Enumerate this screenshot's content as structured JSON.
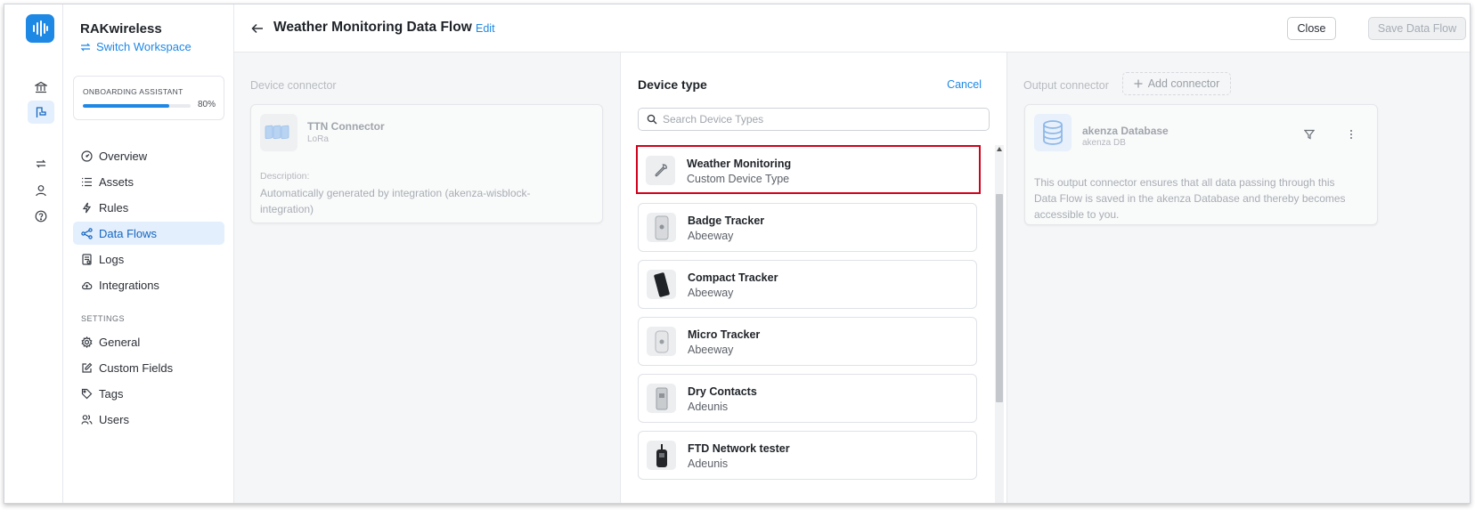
{
  "workspace": {
    "name": "RAKwireless",
    "switch_label": "Switch Workspace"
  },
  "onboarding": {
    "title": "ONBOARDING ASSISTANT",
    "progress_text": "80%",
    "progress": 0.8
  },
  "nav": {
    "items": [
      {
        "label": "Overview",
        "icon": "overview-icon"
      },
      {
        "label": "Assets",
        "icon": "assets-icon"
      },
      {
        "label": "Rules",
        "icon": "rules-icon"
      },
      {
        "label": "Data Flows",
        "icon": "data-flows-icon",
        "active": true
      },
      {
        "label": "Logs",
        "icon": "logs-icon"
      },
      {
        "label": "Integrations",
        "icon": "integrations-icon"
      }
    ],
    "settings_heading": "SETTINGS",
    "settings_items": [
      {
        "label": "General",
        "icon": "general-icon"
      },
      {
        "label": "Custom Fields",
        "icon": "custom-fields-icon"
      },
      {
        "label": "Tags",
        "icon": "tags-icon"
      },
      {
        "label": "Users",
        "icon": "users-icon"
      }
    ]
  },
  "header": {
    "title": "Weather Monitoring Data Flow",
    "edit_label": "Edit",
    "close_label": "Close",
    "save_label": "Save Data Flow"
  },
  "device_connector": {
    "label": "Device connector",
    "name": "TTN Connector",
    "subtitle": "LoRa",
    "description_label": "Description:",
    "description": "Automatically generated by integration (akenza-wisblock-integration)"
  },
  "device_type": {
    "title": "Device type",
    "cancel_label": "Cancel",
    "search_placeholder": "Search Device Types",
    "items": [
      {
        "name": "Weather Monitoring",
        "sub": "Custom Device Type",
        "selected": true
      },
      {
        "name": "Badge Tracker",
        "sub": "Abeeway"
      },
      {
        "name": "Compact Tracker",
        "sub": "Abeeway"
      },
      {
        "name": "Micro Tracker",
        "sub": "Abeeway"
      },
      {
        "name": "Dry Contacts",
        "sub": "Adeunis"
      },
      {
        "name": "FTD Network tester",
        "sub": "Adeunis"
      }
    ]
  },
  "output_connector": {
    "label": "Output connector",
    "add_label": "Add connector",
    "name": "akenza Database",
    "subtitle": "akenza DB",
    "description": "This output connector ensures that all data passing through this Data Flow is saved in the akenza Database and thereby becomes accessible to you."
  },
  "colors": {
    "accent": "#1e88e5",
    "selection_outline": "#d0021b",
    "active_bg": "#e3effd"
  }
}
